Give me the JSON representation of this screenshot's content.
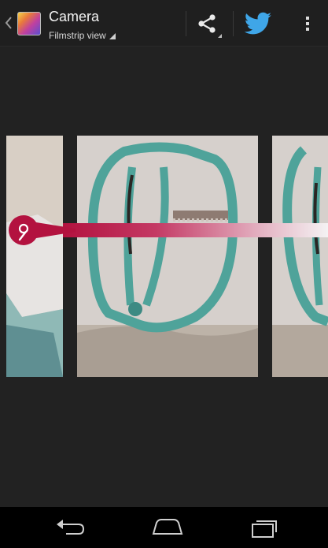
{
  "action_bar": {
    "title": "Camera",
    "subtitle": "Filmstrip view",
    "icons": {
      "up": "chevron-left-icon",
      "app": "gallery-app-icon",
      "share": "share-icon",
      "twitter": "twitter-icon",
      "overflow": "overflow-menu-icon"
    },
    "colors": {
      "background": "#1f1f1f",
      "title": "#f2f2f2",
      "twitter": "#3fa6e8"
    }
  },
  "filmstrip": {
    "photos": [
      {
        "name": "partial-photo-left"
      },
      {
        "name": "current-photo"
      },
      {
        "name": "partial-photo-right"
      }
    ],
    "location_tag": {
      "icon": "location-pin-icon",
      "color": "#b3123f"
    }
  },
  "nav_bar": {
    "buttons": [
      {
        "name": "back",
        "icon": "back-arrow-icon"
      },
      {
        "name": "home",
        "icon": "home-icon"
      },
      {
        "name": "recents",
        "icon": "recent-apps-icon"
      }
    ]
  }
}
